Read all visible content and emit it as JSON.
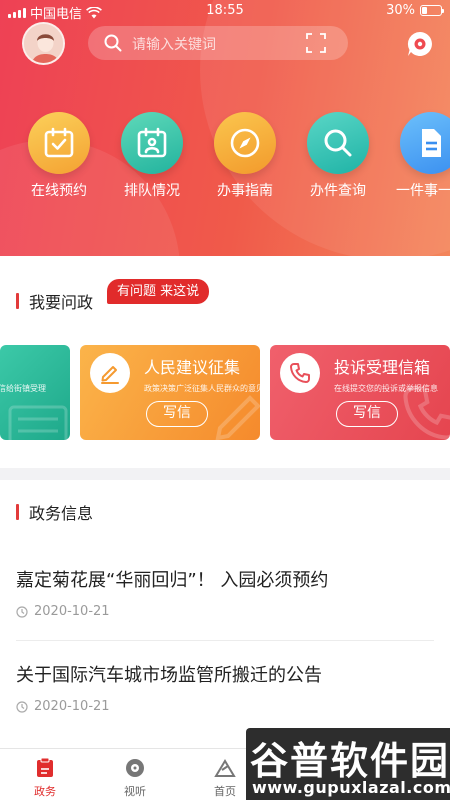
{
  "status": {
    "carrier": "中国电信",
    "time": "18:55",
    "battery": "30%",
    "battery_level": 0.3
  },
  "header": {
    "search_placeholder": "请输入关键词"
  },
  "quick_actions": [
    {
      "label": "在线预约",
      "icon": "calendar-check-icon",
      "color": "#f6b03c"
    },
    {
      "label": "排队情况",
      "icon": "calendar-person-icon",
      "color": "#35c3ab"
    },
    {
      "label": "办事指南",
      "icon": "compass-icon",
      "color": "#f6a93c"
    },
    {
      "label": "办件查询",
      "icon": "magnifier-icon",
      "color": "#2ec4b6"
    },
    {
      "label": "一件事一次",
      "icon": "document-icon",
      "color": "#4a9ff5"
    }
  ],
  "ask_section": {
    "title": "我要问政",
    "bubble": "有问题 来这说",
    "partial_tile": {
      "title": "...",
      "sub": "写信给街镇受理"
    },
    "tiles": [
      {
        "title": "人民建议征集",
        "sub": "政策决策广泛征集人民群众的意见",
        "button": "写信"
      },
      {
        "title": "投诉受理信箱",
        "sub": "在线提交您的投诉或举报信息",
        "button": "写信"
      }
    ]
  },
  "news_section": {
    "title": "政务信息",
    "items": [
      {
        "title": "嘉定菊花展“华丽回归”！ 入园必须预约",
        "date": "2020-10-21"
      },
      {
        "title": "关于国际汽车城市场监管所搬迁的公告",
        "date": "2020-10-21"
      }
    ]
  },
  "tabbar": {
    "tabs": [
      "政务",
      "视听",
      "首页"
    ],
    "active": "政务"
  },
  "watermark": {
    "line1": "谷普软件园",
    "line2": "www.gupuxlazal.com"
  },
  "colors": {
    "brand_red": "#e23a3a",
    "active_tab": "#e02d2d"
  }
}
